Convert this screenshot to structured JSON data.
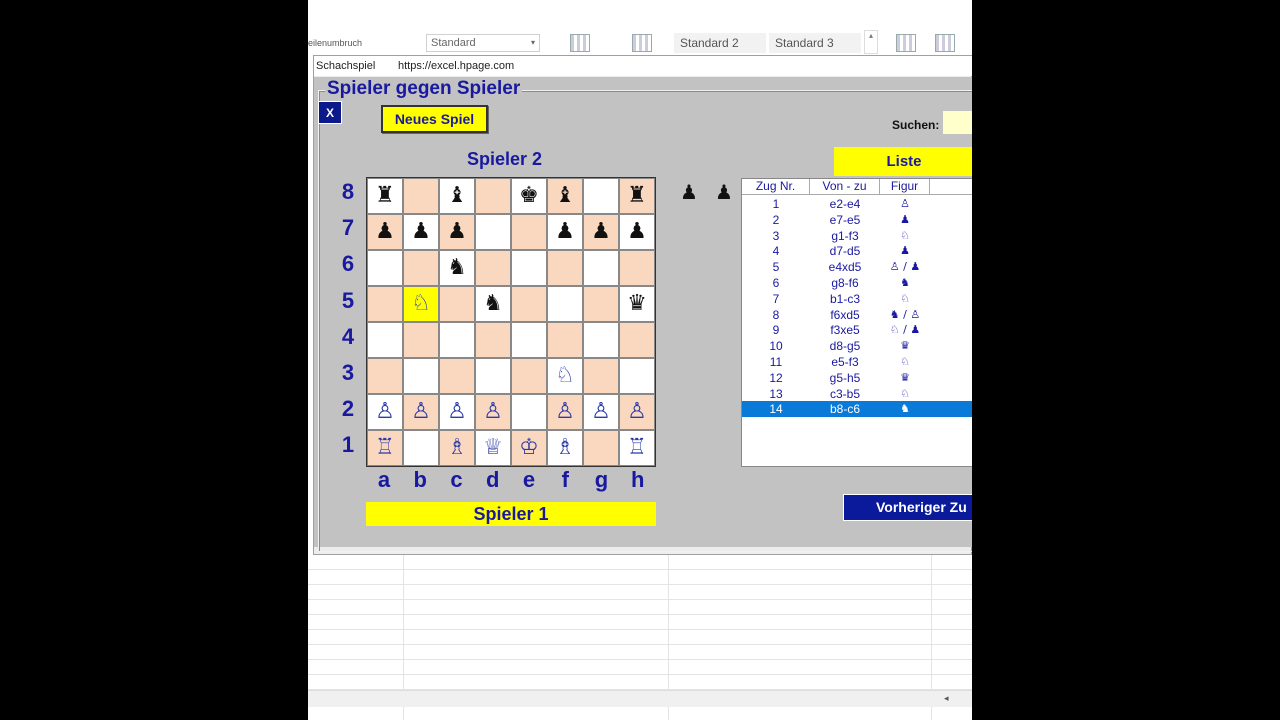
{
  "ribbon": {
    "wrap_label": "eilenumbruch",
    "number_format": "Standard",
    "style_2": "Standard 2",
    "style_3": "Standard 3"
  },
  "window": {
    "title": "Schachspiel",
    "url": "https://excel.hpage.com"
  },
  "dialog": {
    "caption": "Spieler gegen Spieler",
    "close_label": "X",
    "new_game_label": "Neues Spiel",
    "search_label": "Suchen:",
    "search_value": "",
    "player2_label": "Spieler 2",
    "player1_label": "Spieler 1",
    "list_button_label": "Liste",
    "prev_button_label": "Vorheriger Zu"
  },
  "board": {
    "ranks": [
      "8",
      "7",
      "6",
      "5",
      "4",
      "3",
      "2",
      "1"
    ],
    "files": [
      "a",
      "b",
      "c",
      "d",
      "e",
      "f",
      "g",
      "h"
    ],
    "highlight": "b5",
    "rows": [
      [
        "bR",
        "",
        "bB",
        "",
        "bK",
        "bB",
        "",
        "bR"
      ],
      [
        "bP",
        "bP",
        "bP",
        "",
        "",
        "bP",
        "bP",
        "bP"
      ],
      [
        "",
        "",
        "bN",
        "",
        "",
        "",
        "",
        ""
      ],
      [
        "",
        "wN",
        "",
        "bN",
        "",
        "",
        "",
        "bQ"
      ],
      [
        "",
        "",
        "",
        "",
        "",
        "",
        "",
        ""
      ],
      [
        "",
        "",
        "",
        "",
        "",
        "wN",
        "",
        ""
      ],
      [
        "wP",
        "wP",
        "wP",
        "wP",
        "",
        "wP",
        "wP",
        "wP"
      ],
      [
        "wR",
        "",
        "wB",
        "wQ",
        "wK",
        "wB",
        "",
        "wR"
      ]
    ]
  },
  "captured_black": [
    "♟",
    "♟"
  ],
  "movelist": {
    "headers": [
      "Zug Nr.",
      "Von - zu",
      "Figur"
    ],
    "rows": [
      {
        "nr": "1",
        "move": "e2-e4",
        "figure": "♙"
      },
      {
        "nr": "2",
        "move": "e7-e5",
        "figure": "♟"
      },
      {
        "nr": "3",
        "move": "g1-f3",
        "figure": "♘"
      },
      {
        "nr": "4",
        "move": "d7-d5",
        "figure": "♟"
      },
      {
        "nr": "5",
        "move": "e4xd5",
        "figure": "♙ / ♟"
      },
      {
        "nr": "6",
        "move": "g8-f6",
        "figure": "♞"
      },
      {
        "nr": "7",
        "move": "b1-c3",
        "figure": "♘"
      },
      {
        "nr": "8",
        "move": "f6xd5",
        "figure": "♞ / ♙"
      },
      {
        "nr": "9",
        "move": "f3xe5",
        "figure": "♘ / ♟"
      },
      {
        "nr": "10",
        "move": "d8-g5",
        "figure": "♛"
      },
      {
        "nr": "11",
        "move": "e5-f3",
        "figure": "♘"
      },
      {
        "nr": "12",
        "move": "g5-h5",
        "figure": "♛"
      },
      {
        "nr": "13",
        "move": "c3-b5",
        "figure": "♘"
      },
      {
        "nr": "14",
        "move": "b8-c6",
        "figure": "♞"
      }
    ],
    "selected_index": 13
  },
  "colors": {
    "accent_blue": "#1919a0",
    "button_yellow": "#ffff00",
    "light_square": "#ffffff",
    "dark_square": "#fad8bf",
    "selection": "#0a7ad8"
  }
}
